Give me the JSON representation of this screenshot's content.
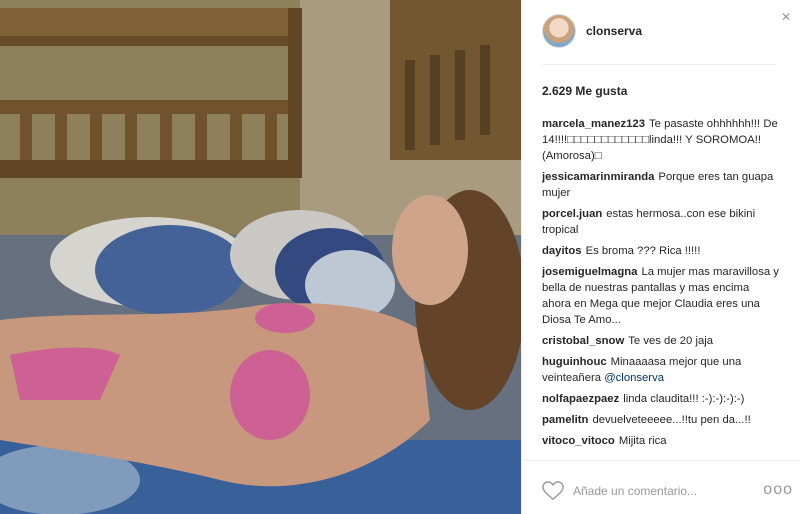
{
  "post": {
    "username": "clonserva",
    "likes": "2.629 Me gusta"
  },
  "comments": [
    {
      "user": "marcela_manez123",
      "text": "Te pasaste ohhhhhh!!! De 14!!!!□□□□□□□□□□□□linda!!! Y SOROMOA!! (Amorosa)□"
    },
    {
      "user": "jessicamarinmiranda",
      "text": "Porque eres tan guapa mujer"
    },
    {
      "user": "porcel.juan",
      "text": "estas hermosa..con ese bikini tropical"
    },
    {
      "user": "dayitos",
      "text": "Es broma ??? Rica !!!!!"
    },
    {
      "user": "josemiguelmagna",
      "text": "La mujer mas maravillosa y bella de nuestras pantallas y mas encima ahora en Mega que mejor Claudia eres una Diosa Te Amo..."
    },
    {
      "user": "cristobal_snow",
      "text": "Te ves de 20 jaja"
    },
    {
      "user": "huguinhouc",
      "text": "Minaaaasa mejor que una veinteañera",
      "mention": "@clonserva"
    },
    {
      "user": "nolfapaezpaez",
      "text": "linda claudita!!! :-):-):-):-)"
    },
    {
      "user": "pamelitn",
      "text": "devuelveteeeee...!!tu pen da...!!"
    },
    {
      "user": "vitoco_vitoco",
      "text": "Mijita rica"
    }
  ],
  "footer": {
    "comment_placeholder": "Añade un comentario...",
    "more_label": "ooo"
  },
  "icons": {
    "close": "close-icon",
    "like": "heart-icon",
    "more": "more-options-icon"
  }
}
